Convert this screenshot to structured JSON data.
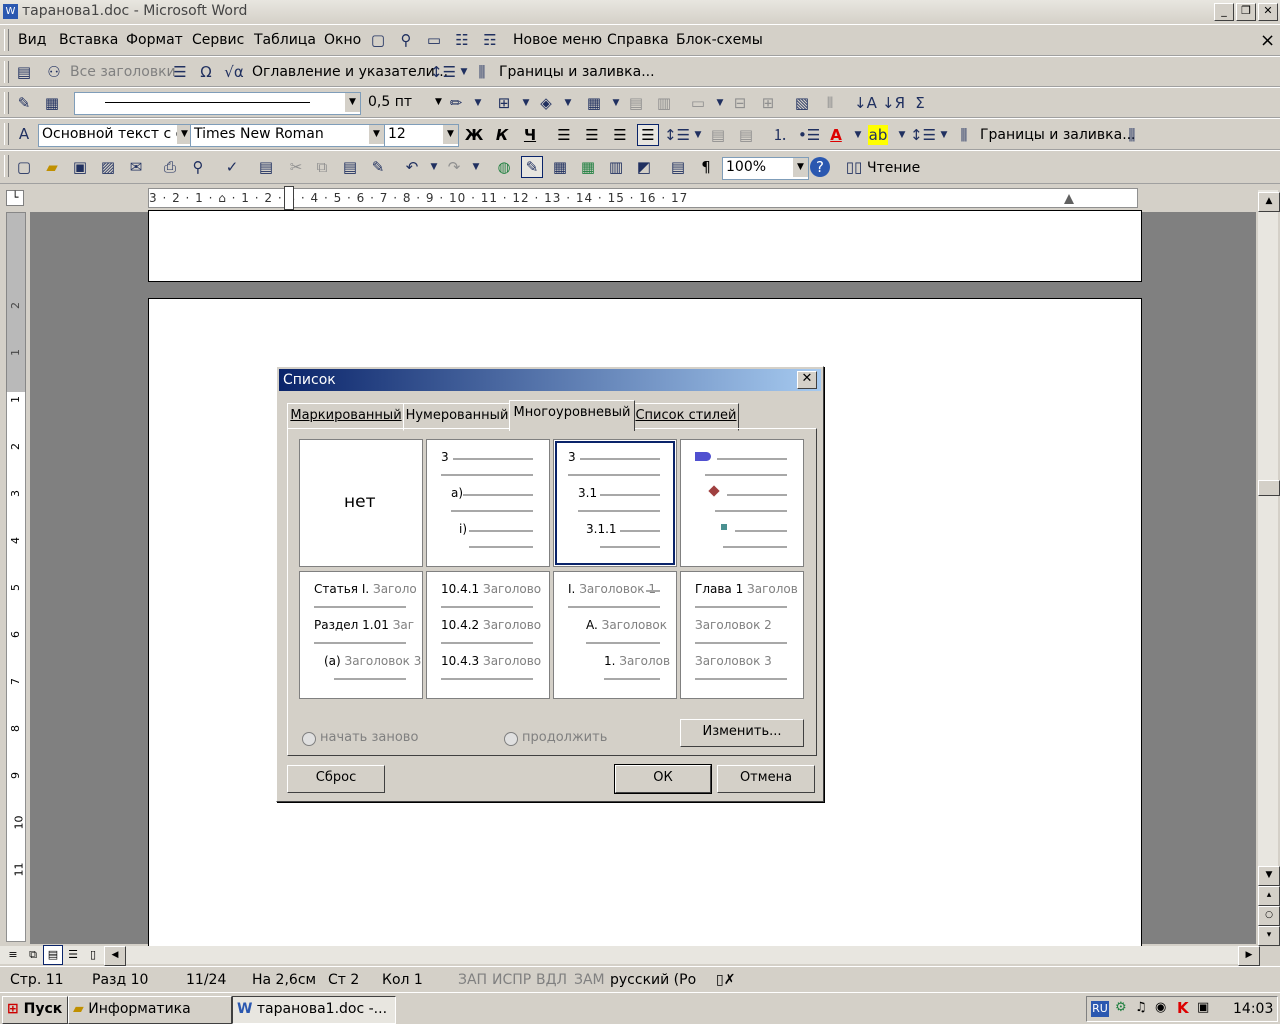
{
  "window": {
    "title": "таранова1.doc - Microsoft Word",
    "min": "_",
    "restore": "❐",
    "close": "✕"
  },
  "menu": {
    "items": [
      "Вид",
      "Вставка",
      "Формат",
      "Сервис",
      "Таблица",
      "Окно"
    ],
    "extra": [
      "Новое меню",
      "Справка",
      "Блок-схемы"
    ],
    "close": "×"
  },
  "toolbar1": {
    "headings": "Все заголовки",
    "toc": "Оглавление и указатели...",
    "borders": "Границы и заливка..."
  },
  "toolbar2": {
    "line_weight": "0,5 пт"
  },
  "toolbar3": {
    "style": "Основной текст с о",
    "font": "Times New Roman",
    "size": "12",
    "bold": "Ж",
    "italic": "К",
    "underline": "Ч",
    "borders": "Границы и заливка..."
  },
  "toolbar4": {
    "zoom": "100%",
    "reading": "Чтение"
  },
  "ruler": {
    "text": "3 · 2 · 1 · ⌂ · 1 · 2 · 3 · 4 · 5 · 6 · 7 · 8 · 9 · 10 · 11 · 12 · 13 · 14 · 15 · 16 · 17"
  },
  "vruler": [
    "2",
    "1",
    "1",
    "2",
    "3",
    "4",
    "5",
    "6",
    "7",
    "8",
    "9",
    "10",
    "11"
  ],
  "dialog": {
    "title": "Список",
    "tabs": [
      "Маркированный",
      "Нумерованный",
      "Многоуровневый",
      "Список стилей"
    ],
    "active_tab": "Многоуровневый",
    "none_label": "нет",
    "grid": {
      "c2": [
        "3",
        "а)",
        "i)"
      ],
      "c3": [
        "3",
        "3.1",
        "3.1.1"
      ],
      "r2c1": [
        {
          "a": "Статья I.",
          "b": "Заголо"
        },
        {
          "a": "Раздел 1.01",
          "b": "Заг"
        },
        {
          "a": "(a)",
          "b": "Заголовок 3"
        }
      ],
      "r2c2": [
        {
          "a": "10.4.1",
          "b": "Заголово"
        },
        {
          "a": "10.4.2",
          "b": "Заголово"
        },
        {
          "a": "10.4.3",
          "b": "Заголово"
        }
      ],
      "r2c3": [
        {
          "a": "I.",
          "b": "Заголовок 1"
        },
        {
          "a": "A.",
          "b": "Заголовок"
        },
        {
          "a": "1.",
          "b": "Заголов"
        }
      ],
      "r2c4": [
        {
          "a": "Глава 1",
          "b": "Заголов"
        },
        {
          "a": "",
          "b": "Заголовок 2"
        },
        {
          "a": "",
          "b": "Заголовок 3"
        }
      ]
    },
    "restart": "начать заново",
    "continue": "продолжить",
    "modify": "Изменить...",
    "reset": "Сброс",
    "ok": "ОК",
    "cancel": "Отмена"
  },
  "status": {
    "page": "Стр. 11",
    "section": "Разд 10",
    "pages": "11/24",
    "at": "На 2,6см",
    "line": "Ст 2",
    "col": "Кол 1",
    "rec": "ЗАП",
    "trk": "ИСПР",
    "ext": "ВДЛ",
    "ovr": "ЗАМ",
    "lang": "русский (Ро"
  },
  "taskbar": {
    "start": "Пуск",
    "task1": "Информатика",
    "task2": "таранова1.doc -...",
    "lang": "RU",
    "time": "14:03"
  }
}
